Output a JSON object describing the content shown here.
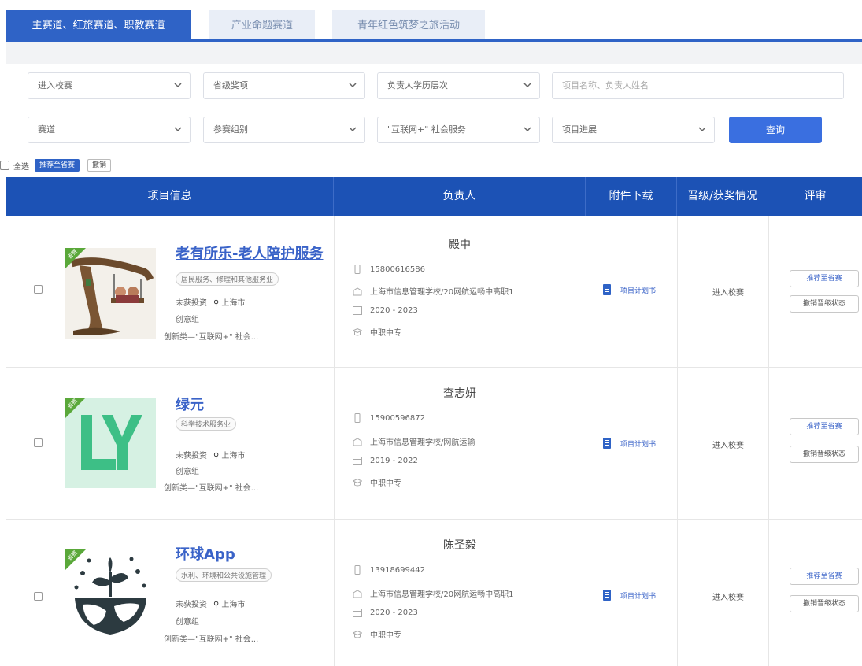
{
  "tabs": [
    {
      "label": "主赛道、红旅赛道、职教赛道",
      "active": true
    },
    {
      "label": "产业命题赛道",
      "active": false
    },
    {
      "label": "青年红色筑梦之旅活动",
      "active": false
    }
  ],
  "filters": {
    "row1": [
      {
        "placeholder": "进入校赛"
      },
      {
        "placeholder": "省级奖项"
      },
      {
        "placeholder": "负责人学历层次"
      }
    ],
    "search_placeholder": "项目名称、负责人姓名",
    "row2": [
      {
        "placeholder": "赛道"
      },
      {
        "placeholder": "参赛组别"
      },
      {
        "placeholder": "\"互联网+\" 社会服务"
      },
      {
        "placeholder": "项目进展"
      }
    ],
    "query_label": "查询"
  },
  "bulk": {
    "select_all": "全选",
    "recommend": "推荐至省赛",
    "cancel": "撤销"
  },
  "table": {
    "headers": [
      "项目信息",
      "负责人",
      "附件下载",
      "晋级/获奖情况",
      "评审"
    ],
    "rows": [
      {
        "name": "老有所乐-老人陪护服务",
        "tag": "居民服务、修理和其他服务业",
        "investment": "未获投资",
        "city": "上海市",
        "group": "创意组",
        "category": "创新类—\"互联网+\" 社会...",
        "ribbon": "省赛",
        "leader": "殿中",
        "phone": "15800616586",
        "school": "上海市信息管理学校/20网航运畅中高职1",
        "years": "2020 - 2023",
        "level": "中职中专",
        "attachment": "项目计划书",
        "status": "进入校赛",
        "btn_recommend": "推荐至省赛",
        "btn_revoke": "撤销晋级状态"
      },
      {
        "name": "绿元",
        "tag": "科学技术服务业",
        "investment": "未获投资",
        "city": "上海市",
        "group": "创意组",
        "category": "创新类—\"互联网+\" 社会...",
        "ribbon": "省赛",
        "leader": "查志妍",
        "phone": "15900596872",
        "school": "上海市信息管理学校/网航运输",
        "years": "2019 - 2022",
        "level": "中职中专",
        "attachment": "项目计划书",
        "status": "进入校赛",
        "btn_recommend": "推荐至省赛",
        "btn_revoke": "撤销晋级状态"
      },
      {
        "name": "环球App",
        "tag": "水利、环境和公共设施管理",
        "investment": "未获投资",
        "city": "上海市",
        "group": "创意组",
        "category": "创新类—\"互联网+\" 社会...",
        "ribbon": "省赛",
        "leader": "陈圣毅",
        "phone": "13918699442",
        "school": "上海市信息管理学校/20网航运畅中高职1",
        "years": "2020 - 2023",
        "level": "中职中专",
        "attachment": "项目计划书",
        "status": "进入校赛",
        "btn_recommend": "推荐至省赛",
        "btn_revoke": "撤销晋级状态"
      }
    ]
  },
  "colors": {
    "primary": "#2f63c6",
    "header": "#1c52b5",
    "link": "#3a63c8",
    "ribbon": "#5aa83a",
    "logo_green": "#3dbf86"
  }
}
